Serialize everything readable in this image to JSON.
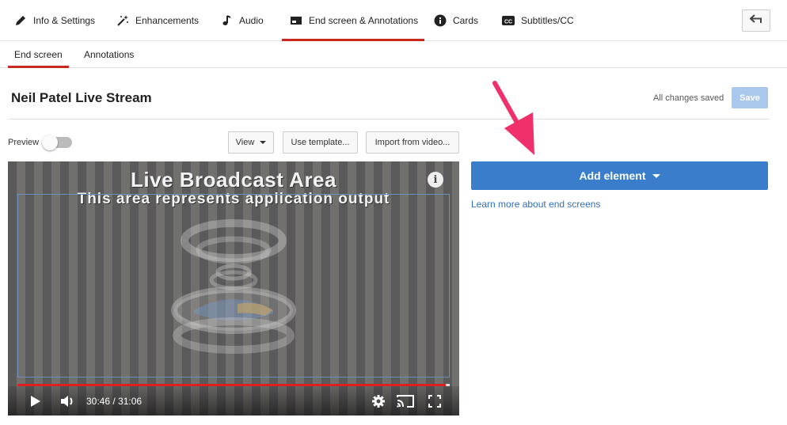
{
  "tabs": [
    {
      "label": "Info & Settings",
      "icon": "pencil-icon"
    },
    {
      "label": "Enhancements",
      "icon": "magic-wand-icon"
    },
    {
      "label": "Audio",
      "icon": "music-note-icon"
    },
    {
      "label": "End screen & Annotations",
      "icon": "end-screen-icon",
      "active": true
    },
    {
      "label": "Cards",
      "icon": "info-circle-icon"
    },
    {
      "label": "Subtitles/CC",
      "icon": "cc-icon"
    }
  ],
  "subtabs": [
    {
      "label": "End screen",
      "active": true
    },
    {
      "label": "Annotations"
    }
  ],
  "page": {
    "title": "Neil Patel Live Stream",
    "status": "All changes saved",
    "save_label": "Save"
  },
  "toolbar": {
    "preview_label": "Preview",
    "preview_on": false,
    "view_label": "View",
    "template_label": "Use template...",
    "import_label": "Import from video..."
  },
  "video": {
    "overlay_title": "Live Broadcast Area",
    "overlay_subtitle": "This area represents application output",
    "info_glyph": "i",
    "time": "30:46 / 31:06",
    "progress": 0.99
  },
  "panel": {
    "add_element_label": "Add element",
    "learn_link": "Learn more about end screens"
  },
  "colors": {
    "accent_red": "#c8281e",
    "button_blue": "#3a7ecb",
    "link_blue": "#2f6fbd",
    "arrow_pink": "#f0306a"
  }
}
